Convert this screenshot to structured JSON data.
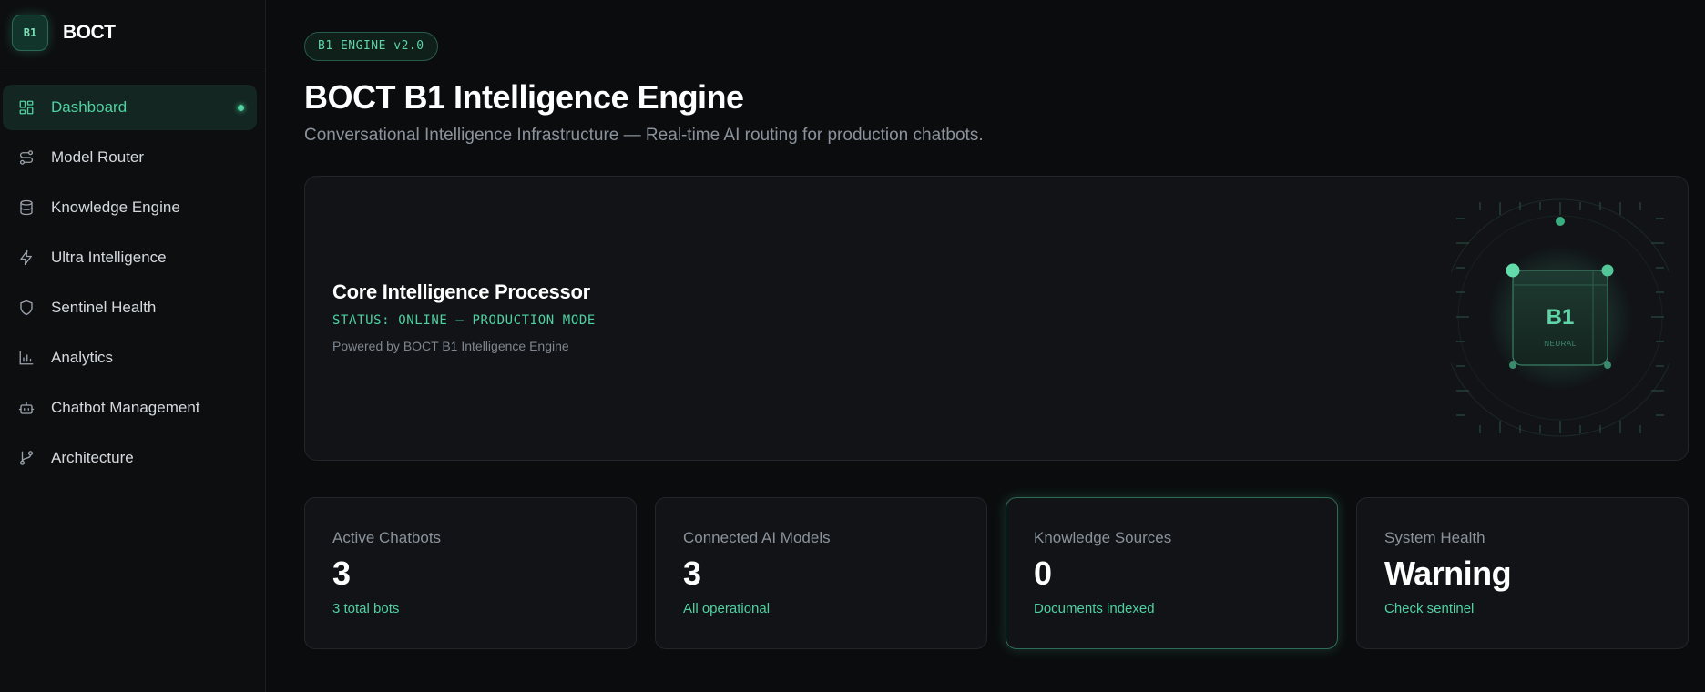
{
  "brand": {
    "logo_text": "B1",
    "name": "BOCT"
  },
  "sidebar": {
    "items": [
      {
        "label": "Dashboard",
        "icon": "dashboard-grid-icon",
        "active": true
      },
      {
        "label": "Model Router",
        "icon": "route-icon"
      },
      {
        "label": "Knowledge Engine",
        "icon": "database-icon"
      },
      {
        "label": "Ultra Intelligence",
        "icon": "lightning-icon"
      },
      {
        "label": "Sentinel Health",
        "icon": "shield-icon"
      },
      {
        "label": "Analytics",
        "icon": "bar-chart-icon"
      },
      {
        "label": "Chatbot Management",
        "icon": "bot-icon"
      },
      {
        "label": "Architecture",
        "icon": "git-branch-icon"
      }
    ]
  },
  "header": {
    "badge": "B1 ENGINE v2.0",
    "title": "BOCT B1 Intelligence Engine",
    "subtitle": "Conversational Intelligence Infrastructure — Real-time AI routing for production chatbots."
  },
  "hero": {
    "title": "Core Intelligence Processor",
    "status": "STATUS: ONLINE — PRODUCTION MODE",
    "powered_by": "Powered by BOCT B1 Intelligence Engine",
    "chip_label": "B1",
    "chip_sublabel": "NEURAL"
  },
  "stats": [
    {
      "label": "Active Chatbots",
      "value": "3",
      "sub": "3 total bots"
    },
    {
      "label": "Connected AI Models",
      "value": "3",
      "sub": "All operational"
    },
    {
      "label": "Knowledge Sources",
      "value": "0",
      "sub": "Documents indexed"
    },
    {
      "label": "System Health",
      "value": "Warning",
      "sub": "Check sentinel"
    }
  ],
  "colors": {
    "accent": "#4fd1a0",
    "background": "#0b0c0e",
    "card": "#111316",
    "border": "#22262b"
  }
}
